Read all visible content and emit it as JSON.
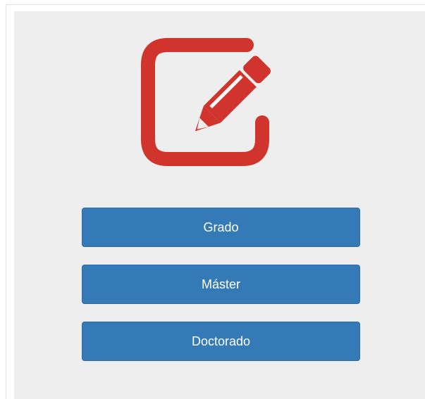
{
  "main": {
    "icon": "edit-icon",
    "accent_color": "#d0342c",
    "button_color": "#337ab7",
    "buttons": [
      {
        "label": "Grado"
      },
      {
        "label": "Máster"
      },
      {
        "label": "Doctorado"
      }
    ]
  }
}
